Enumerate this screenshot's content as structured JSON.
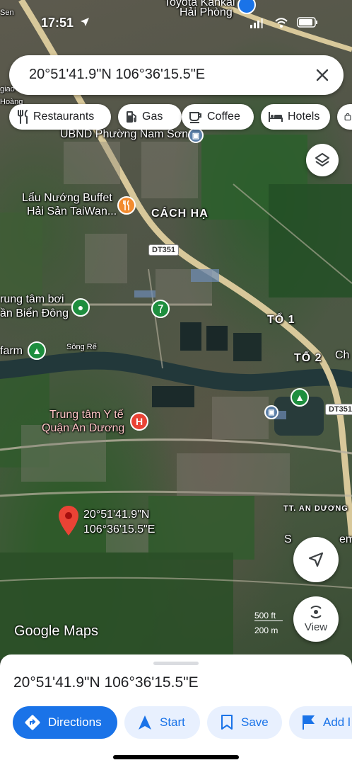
{
  "status_bar": {
    "time": "17:51"
  },
  "search": {
    "query": "20°51'41.9\"N 106°36'15.5\"E"
  },
  "chips": [
    {
      "label": "Restaurants",
      "icon": "fork-knife-icon"
    },
    {
      "label": "Gas",
      "icon": "gas-pump-icon"
    },
    {
      "label": "Coffee",
      "icon": "coffee-cup-icon"
    },
    {
      "label": "Hotels",
      "icon": "bed-icon"
    }
  ],
  "map": {
    "labels": {
      "toyota": "Toyota Kankai",
      "haiphong": "Hải Phòng",
      "ubnd": "UBND Phường Nam Sơn",
      "buffet_line1": "Lẩu Nướng Buffet",
      "buffet_line2": "Hải Sản TaiWan...",
      "cach_ha": "CÁCH HẠ",
      "dt351_a": "DT351",
      "dt351_b": "DT351",
      "trung_tam_boi_1": "rung tâm bơi",
      "trung_tam_boi_2": "ần Biển Đông",
      "to1": "TỔ 1",
      "to2": "TỔ 2",
      "ch": "Ch",
      "farm": "farm",
      "song_re": "Sông Rế",
      "hospital_line1": "Trung tâm Y tế",
      "hospital_line2": "Quận An Dương",
      "tt_an_duong": "TT. AN DƯƠNG",
      "giao": "giao",
      "hoang": "Hoàng",
      "sen": "Sen",
      "s_em": "S",
      "em": "em",
      "pin_line1": "20°51'41.9\"N",
      "pin_line2": "106°36'15.5\"E",
      "scale_ft": "500 ft",
      "scale_m": "200 m",
      "google_maps": "Google Maps",
      "view": "View"
    }
  },
  "sheet": {
    "title": "20°51'41.9\"N 106°36'15.5\"E",
    "actions": [
      {
        "label": "Directions",
        "icon": "directions-icon"
      },
      {
        "label": "Start",
        "icon": "navigation-arrow-icon"
      },
      {
        "label": "Save",
        "icon": "bookmark-icon"
      },
      {
        "label": "Add l",
        "icon": "flag-icon"
      }
    ]
  },
  "colors": {
    "accent_blue": "#1a73e8",
    "pin_red": "#ea4335",
    "park_green": "#1e8e3e",
    "chip_bg": "#ffffff"
  }
}
